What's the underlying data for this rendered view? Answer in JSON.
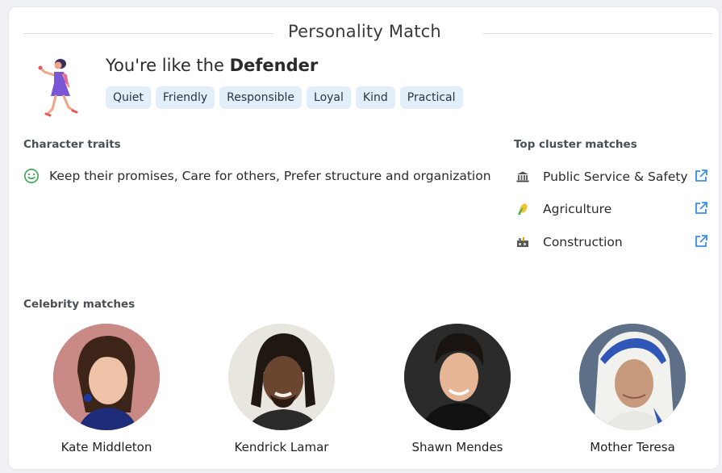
{
  "card": {
    "title": "Personality Match",
    "headline_prefix": "You're like the ",
    "headline_type": "Defender",
    "tags": [
      "Quiet",
      "Friendly",
      "Responsible",
      "Loyal",
      "Kind",
      "Practical"
    ]
  },
  "traits": {
    "heading": "Character traits",
    "text": "Keep their promises, Care for others, Prefer structure and organization"
  },
  "clusters": {
    "heading": "Top cluster matches",
    "items": [
      {
        "label": "Public Service & Safety",
        "icon": "government-building-icon"
      },
      {
        "label": "Agriculture",
        "icon": "corn-icon"
      },
      {
        "label": "Construction",
        "icon": "construction-icon"
      }
    ]
  },
  "celebrities": {
    "heading": "Celebrity matches",
    "items": [
      {
        "name": "Kate Middleton"
      },
      {
        "name": "Kendrick Lamar"
      },
      {
        "name": "Shawn Mendes"
      },
      {
        "name": "Mother Teresa"
      }
    ]
  },
  "colors": {
    "tag_bg": "#e3eefb",
    "link_blue": "#3b8ee8",
    "smile_green": "#3aa55a"
  }
}
